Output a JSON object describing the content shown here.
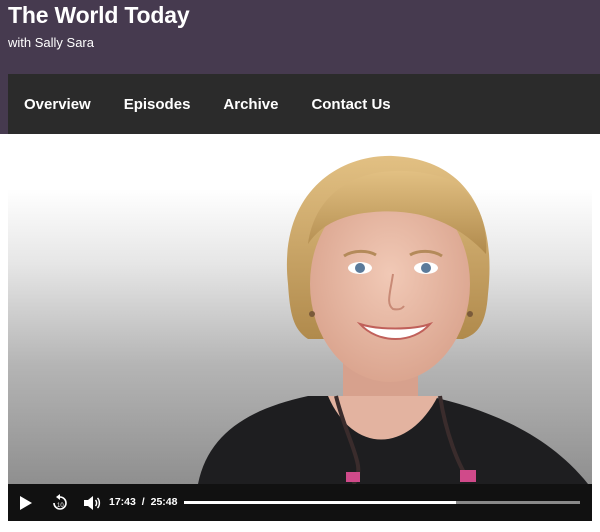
{
  "header": {
    "title": "The World Today",
    "subtitle": "with Sally Sara",
    "background_color": "#463a4f"
  },
  "nav": {
    "background_color": "#2b2b2b",
    "items": [
      {
        "label": "Overview"
      },
      {
        "label": "Episodes"
      },
      {
        "label": "Archive"
      },
      {
        "label": "Contact Us"
      }
    ]
  },
  "player": {
    "current_time": "17:43",
    "separator": "/",
    "duration": "25:48",
    "progress_fraction": 0.687,
    "icons": [
      "play-icon",
      "rewind-10-icon",
      "volume-icon"
    ]
  }
}
